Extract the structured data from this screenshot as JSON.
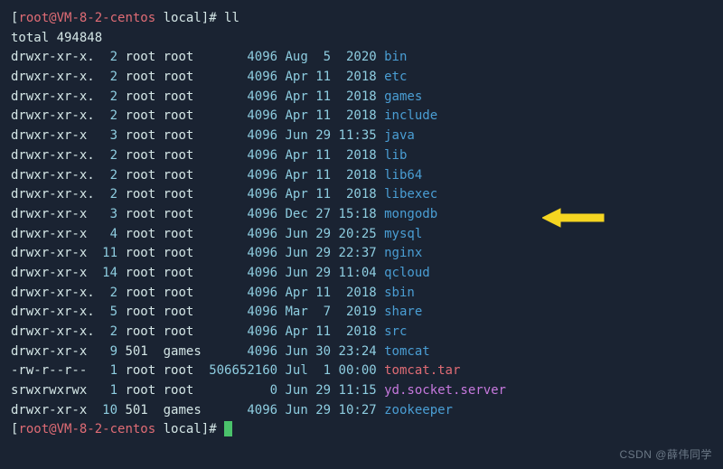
{
  "prompt": {
    "user_host": "root@VM-8-2-centos",
    "path": "local",
    "command": "ll"
  },
  "total_line": "total 494848",
  "rows": [
    {
      "perms": "drwxr-xr-x.",
      "links": "2",
      "owner": "root",
      "group": "root",
      "size": "4096",
      "month": "Aug",
      "day": "5",
      "time": "2020",
      "name": "bin",
      "kind": "dir"
    },
    {
      "perms": "drwxr-xr-x.",
      "links": "2",
      "owner": "root",
      "group": "root",
      "size": "4096",
      "month": "Apr",
      "day": "11",
      "time": "2018",
      "name": "etc",
      "kind": "dir"
    },
    {
      "perms": "drwxr-xr-x.",
      "links": "2",
      "owner": "root",
      "group": "root",
      "size": "4096",
      "month": "Apr",
      "day": "11",
      "time": "2018",
      "name": "games",
      "kind": "dir"
    },
    {
      "perms": "drwxr-xr-x.",
      "links": "2",
      "owner": "root",
      "group": "root",
      "size": "4096",
      "month": "Apr",
      "day": "11",
      "time": "2018",
      "name": "include",
      "kind": "dir"
    },
    {
      "perms": "drwxr-xr-x",
      "links": "3",
      "owner": "root",
      "group": "root",
      "size": "4096",
      "month": "Jun",
      "day": "29",
      "time": "11:35",
      "name": "java",
      "kind": "dir"
    },
    {
      "perms": "drwxr-xr-x.",
      "links": "2",
      "owner": "root",
      "group": "root",
      "size": "4096",
      "month": "Apr",
      "day": "11",
      "time": "2018",
      "name": "lib",
      "kind": "dir"
    },
    {
      "perms": "drwxr-xr-x.",
      "links": "2",
      "owner": "root",
      "group": "root",
      "size": "4096",
      "month": "Apr",
      "day": "11",
      "time": "2018",
      "name": "lib64",
      "kind": "dir"
    },
    {
      "perms": "drwxr-xr-x.",
      "links": "2",
      "owner": "root",
      "group": "root",
      "size": "4096",
      "month": "Apr",
      "day": "11",
      "time": "2018",
      "name": "libexec",
      "kind": "dir"
    },
    {
      "perms": "drwxr-xr-x",
      "links": "3",
      "owner": "root",
      "group": "root",
      "size": "4096",
      "month": "Dec",
      "day": "27",
      "time": "15:18",
      "name": "mongodb",
      "kind": "dir"
    },
    {
      "perms": "drwxr-xr-x",
      "links": "4",
      "owner": "root",
      "group": "root",
      "size": "4096",
      "month": "Jun",
      "day": "29",
      "time": "20:25",
      "name": "mysql",
      "kind": "dir"
    },
    {
      "perms": "drwxr-xr-x",
      "links": "11",
      "owner": "root",
      "group": "root",
      "size": "4096",
      "month": "Jun",
      "day": "29",
      "time": "22:37",
      "name": "nginx",
      "kind": "dir"
    },
    {
      "perms": "drwxr-xr-x",
      "links": "14",
      "owner": "root",
      "group": "root",
      "size": "4096",
      "month": "Jun",
      "day": "29",
      "time": "11:04",
      "name": "qcloud",
      "kind": "dir"
    },
    {
      "perms": "drwxr-xr-x.",
      "links": "2",
      "owner": "root",
      "group": "root",
      "size": "4096",
      "month": "Apr",
      "day": "11",
      "time": "2018",
      "name": "sbin",
      "kind": "dir"
    },
    {
      "perms": "drwxr-xr-x.",
      "links": "5",
      "owner": "root",
      "group": "root",
      "size": "4096",
      "month": "Mar",
      "day": "7",
      "time": "2019",
      "name": "share",
      "kind": "dir"
    },
    {
      "perms": "drwxr-xr-x.",
      "links": "2",
      "owner": "root",
      "group": "root",
      "size": "4096",
      "month": "Apr",
      "day": "11",
      "time": "2018",
      "name": "src",
      "kind": "dir"
    },
    {
      "perms": "drwxr-xr-x",
      "links": "9",
      "owner": "501",
      "group": "games",
      "size": "4096",
      "month": "Jun",
      "day": "30",
      "time": "23:24",
      "name": "tomcat",
      "kind": "dir"
    },
    {
      "perms": "-rw-r--r--",
      "links": "1",
      "owner": "root",
      "group": "root",
      "size": "506652160",
      "month": "Jul",
      "day": "1",
      "time": "00:00",
      "name": "tomcat.tar",
      "kind": "tar"
    },
    {
      "perms": "srwxrwxrwx",
      "links": "1",
      "owner": "root",
      "group": "root",
      "size": "0",
      "month": "Jun",
      "day": "29",
      "time": "11:15",
      "name": "yd.socket.server",
      "kind": "link"
    },
    {
      "perms": "drwxr-xr-x",
      "links": "10",
      "owner": "501",
      "group": "games",
      "size": "4096",
      "month": "Jun",
      "day": "29",
      "time": "10:27",
      "name": "zookeeper",
      "kind": "dir"
    }
  ],
  "watermark": "CSDN @薛伟同学"
}
